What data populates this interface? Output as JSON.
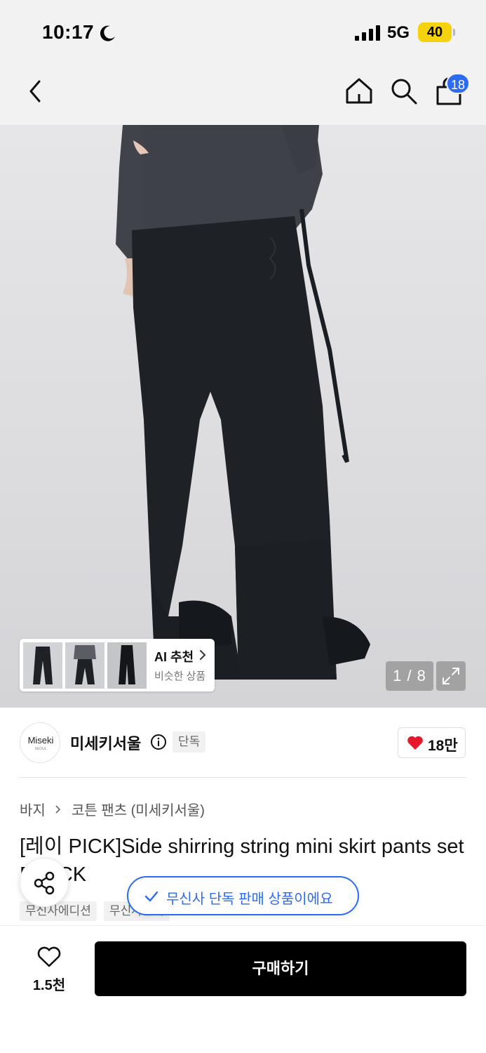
{
  "status_bar": {
    "time": "10:17",
    "network": "5G",
    "battery": "40"
  },
  "header": {
    "cart_count": "18",
    "icons": [
      "back-icon",
      "home-icon",
      "search-icon",
      "cart-icon"
    ]
  },
  "gallery": {
    "counter": "1 / 8",
    "ai_recommend": {
      "title": "AI 추천",
      "subtitle": "비슷한 상품"
    }
  },
  "brand": {
    "logo_text": "Miseki",
    "logo_subtext": "SEOUL",
    "name": "미세키서울",
    "exclusive_tag": "단독",
    "likes": "18만"
  },
  "breadcrumb": {
    "category": "바지",
    "subcategory": "코튼 팬츠 (미세키서울)"
  },
  "product": {
    "title": "[레이 PICK]Side shirring string mini skirt pants set BLACK",
    "tags": [
      "무신사에디션",
      "무신사단독"
    ]
  },
  "toast": {
    "text": "무신사 단독 판매 상품이에요"
  },
  "bottom_bar": {
    "wish_count": "1.5천",
    "buy_label": "구매하기"
  },
  "colors": {
    "accent_blue": "#2c6bf2",
    "heart_red": "#e8182c",
    "buy_button": "#000000",
    "battery_yellow": "#f5d20c"
  }
}
